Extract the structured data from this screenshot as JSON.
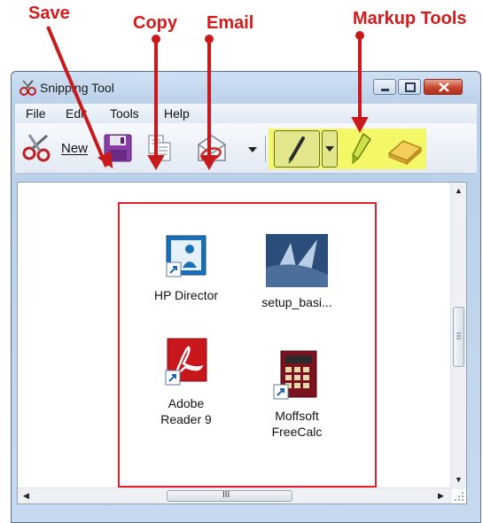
{
  "callouts": {
    "save": "Save",
    "copy": "Copy",
    "email": "Email",
    "markup_tools": "Markup Tools"
  },
  "window": {
    "title": "Snipping Tool",
    "buttons": {
      "minimize": "minimize-icon",
      "maximize": "maximize-icon",
      "close": "close-icon"
    }
  },
  "menu": [
    "File",
    "Edit",
    "Tools",
    "Help"
  ],
  "toolbar": {
    "new_label": "New",
    "icons": [
      "scissors-icon",
      "save-icon",
      "copy-icon",
      "email-icon",
      "dropdown-arrow-icon",
      "pen-icon",
      "pen-dropdown-icon",
      "highlighter-icon",
      "eraser-icon"
    ]
  },
  "snip": {
    "items": [
      {
        "label": "HP Director",
        "icon": "hp-director-icon"
      },
      {
        "label": "setup_basi...",
        "icon": "setup-icon"
      },
      {
        "label": "Adobe\nReader 9",
        "label_line1": "Adobe",
        "label_line2": "Reader 9",
        "icon": "adobe-reader-icon"
      },
      {
        "label": "Moffsoft\nFreeCalc",
        "label_line1": "Moffsoft",
        "label_line2": "FreeCalc",
        "icon": "calculator-icon"
      }
    ]
  },
  "scrollbar": {
    "grip": "III"
  },
  "colors": {
    "callout": "#d41a1a",
    "highlight": "#f4f766",
    "snip_border": "#e0202a"
  }
}
